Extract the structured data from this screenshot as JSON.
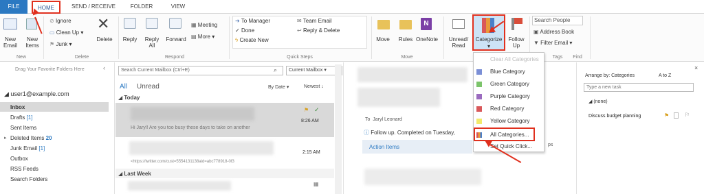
{
  "tabs": [
    "FILE",
    "HOME",
    "SEND / RECEIVE",
    "FOLDER",
    "VIEW"
  ],
  "ribbon": {
    "new_group": {
      "new_email": "New\nEmail",
      "new_items": "New\nItems",
      "label": "New"
    },
    "delete_group": {
      "ignore": "Ignore",
      "clean_up": "Clean Up",
      "junk": "Junk",
      "delete": "Delete",
      "label": "Delete"
    },
    "respond_group": {
      "reply": "Reply",
      "reply_all": "Reply\nAll",
      "forward": "Forward",
      "meeting": "Meeting",
      "more": "More",
      "label": "Respond"
    },
    "quick_steps": {
      "to_manager": "To Manager",
      "done": "Done",
      "create_new": "Create New",
      "team_email": "Team Email",
      "reply_delete": "Reply & Delete",
      "label": "Quick Steps"
    },
    "move_group": {
      "move": "Move",
      "rules": "Rules",
      "onenote": "OneNote",
      "label": "Move"
    },
    "tags_group": {
      "unread_read": "Unread/\nRead",
      "categorize": "Categorize",
      "follow_up": "Follow\nUp",
      "label": "Tags"
    },
    "find_group": {
      "search_people_placeholder": "Search People",
      "address_book": "Address Book",
      "filter_email": "Filter Email",
      "label": "Find"
    }
  },
  "folder_pane": {
    "drag_hint": "Drag Your Favorite Folders Here",
    "account": "user1@example.com",
    "folders": [
      {
        "name": "Inbox",
        "count": ""
      },
      {
        "name": "Drafts",
        "count": "[1]"
      },
      {
        "name": "Sent Items",
        "count": ""
      },
      {
        "name": "Deleted Items",
        "count": "20"
      },
      {
        "name": "Junk Email",
        "count": "[1]"
      },
      {
        "name": "Outbox",
        "count": ""
      },
      {
        "name": "RSS Feeds",
        "count": ""
      },
      {
        "name": "Search Folders",
        "count": ""
      }
    ]
  },
  "mail_list": {
    "search_placeholder": "Search Current Mailbox (Ctrl+E)",
    "scope": "Current Mailbox",
    "filter_all": "All",
    "filter_unread": "Unread",
    "sort_by": "By Date",
    "sort_order": "Newest",
    "group_today": "Today",
    "group_last_week": "Last Week",
    "items": [
      {
        "preview": "Hi Jaryl! Are you too busy these days to take on another",
        "time": "8:26 AM"
      },
      {
        "preview": "<https://twitter.com/cust=5554131138aid=abc778918-0f3",
        "time": "2:15 AM"
      }
    ]
  },
  "reading_pane": {
    "to_label": "To",
    "to_name": "Jaryl Leonard",
    "follow_up": "Follow up.  Completed on Tuesday,",
    "action_items": "Action Items"
  },
  "category_menu": {
    "clear_all": "Clear All Categories",
    "items": [
      {
        "label": "Blue Category",
        "color": "#7b8fd6"
      },
      {
        "label": "Green Category",
        "color": "#7cc46b"
      },
      {
        "label": "Purple Category",
        "color": "#9b6bbf"
      },
      {
        "label": "Red Category",
        "color": "#d9585a"
      },
      {
        "label": "Yellow Category",
        "color": "#f2ea6b"
      }
    ],
    "all_categories": "All Categories...",
    "set_quick_click": "Set Quick Click..."
  },
  "todo_pane": {
    "arrange_by": "Arrange by: Categories",
    "sort": "A to Z",
    "new_task_placeholder": "Type a new task",
    "group_none": "(none)",
    "task": "Discuss budget planning"
  },
  "colors": {
    "accent": "#2b79c2",
    "highlight": "#e0301e"
  }
}
